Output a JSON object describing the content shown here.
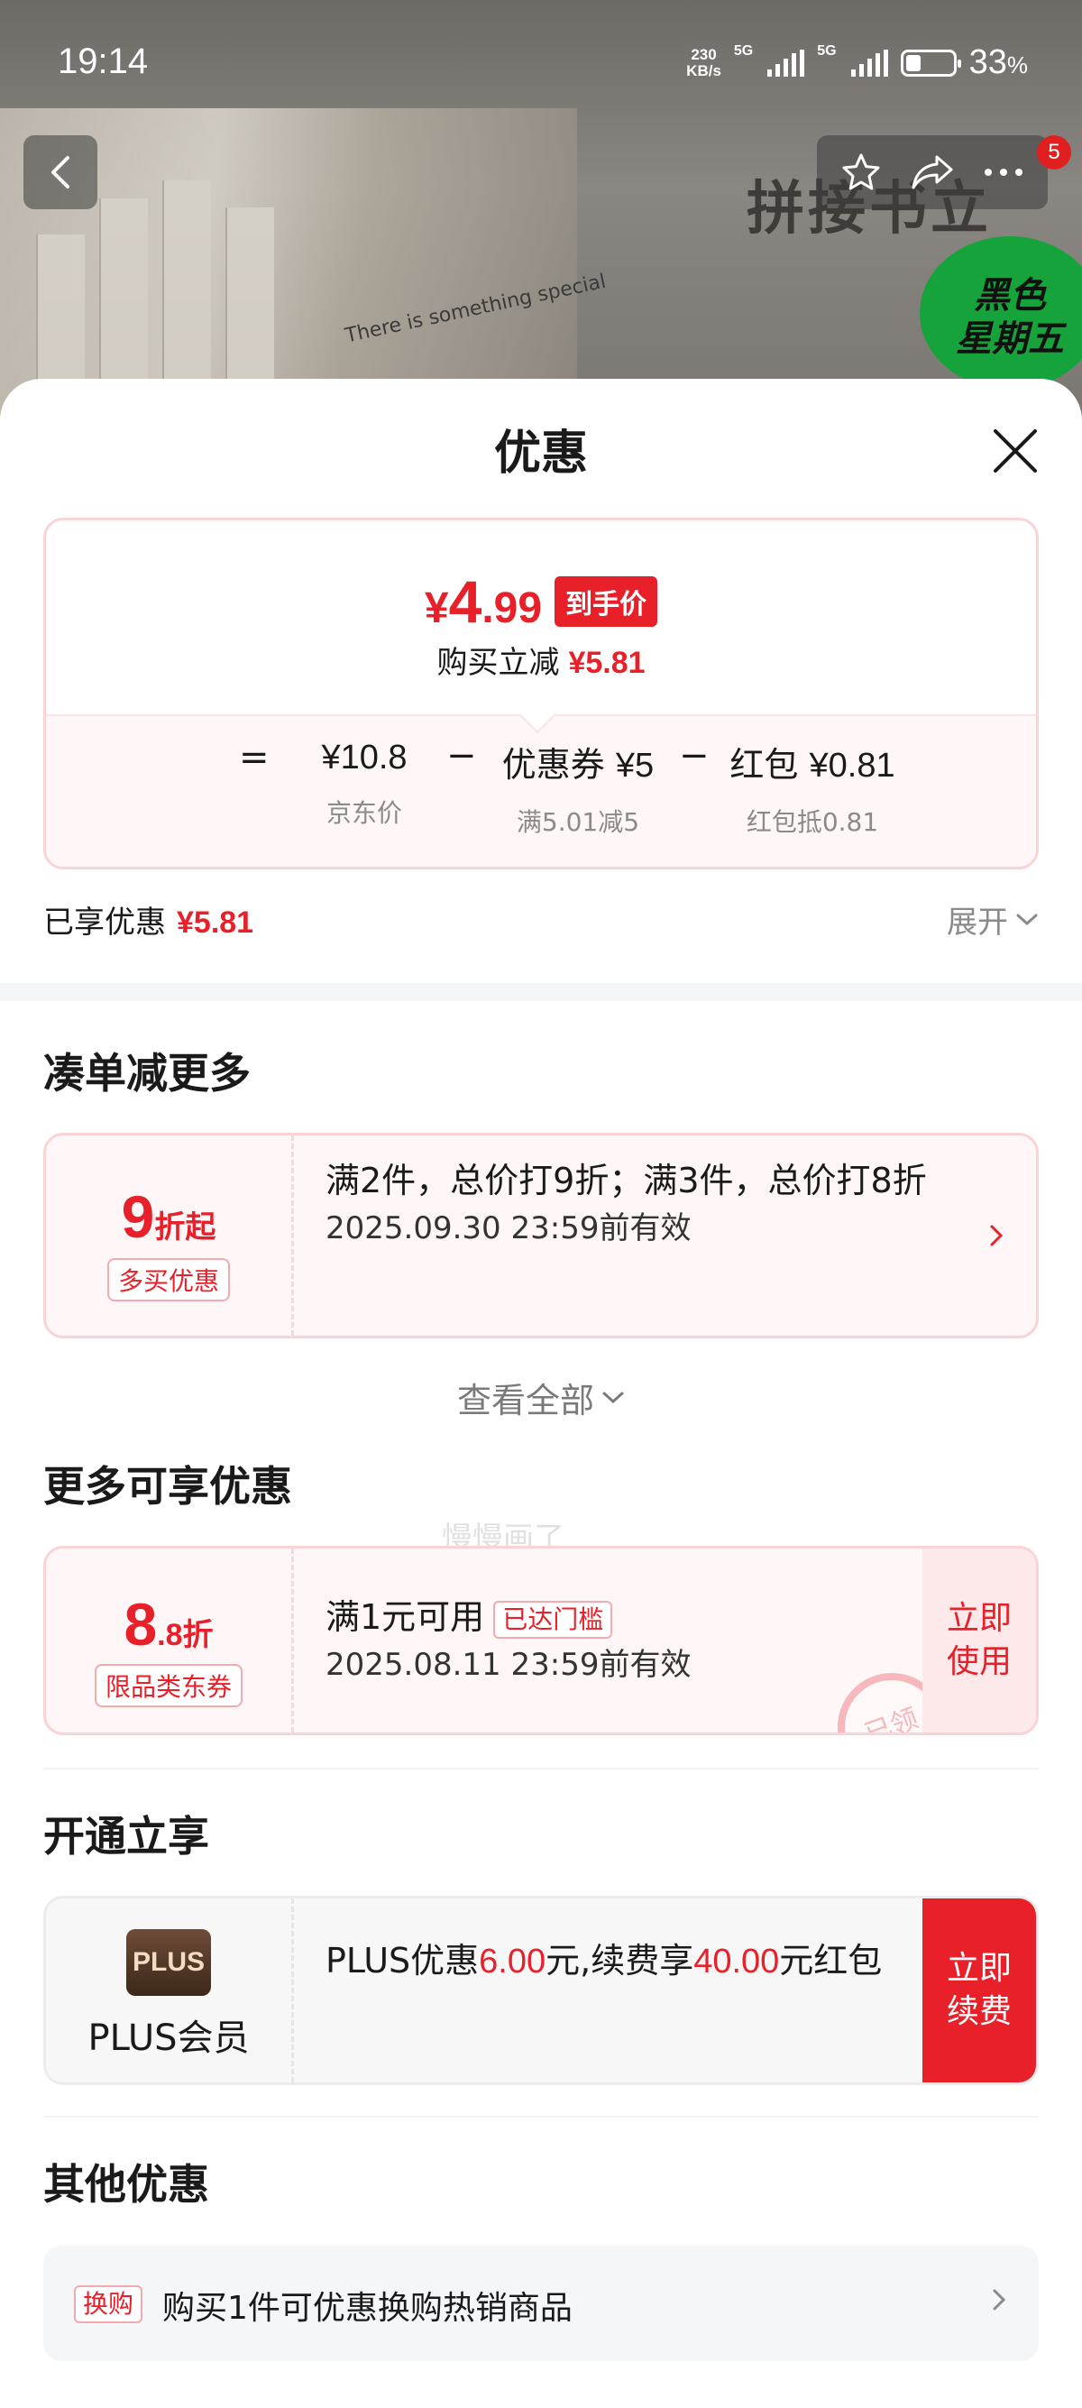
{
  "status_bar": {
    "time": "19:14",
    "net_speed": "230\nKB/s",
    "sig1": "5G",
    "sig2": "5G",
    "battery_pct": "33",
    "battery_unit": "%"
  },
  "background": {
    "tagline": "There is something special",
    "title_art": "拼接书立",
    "promo": "黑色\n星期五",
    "cart_badge": "5"
  },
  "sheet": {
    "title": "优惠"
  },
  "summary": {
    "final_yen": "¥",
    "final_int": "4",
    "final_dec": ".99",
    "final_tag": "到手价",
    "reduce_label": "购买立减",
    "reduce_amount": "¥5.81",
    "calc": {
      "eq": "=",
      "minus1": "−",
      "minus2": "−",
      "items": [
        {
          "value": "¥10.8",
          "label": "京东价"
        },
        {
          "value_prefix": "优惠券",
          "value": "¥5",
          "label": "满5.01减5"
        },
        {
          "value_prefix": "红包",
          "value": "¥0.81",
          "label": "红包抵0.81"
        }
      ]
    }
  },
  "enjoyed": {
    "label": "已享优惠",
    "amount": "¥5.81",
    "expand": "展开"
  },
  "section1": {
    "title": "凑单减更多",
    "card": {
      "big": "9",
      "big_suffix": "折起",
      "tag": "多买优惠",
      "line1": "满2件，总价打9折；满3件，总价打8折",
      "line2": "2025.09.30 23:59前有效"
    },
    "view_all": "查看全部",
    "watermark": "慢慢画了"
  },
  "section2": {
    "title": "更多可享优惠",
    "card": {
      "big": "8",
      "big_dec": ".8",
      "big_suffix": "折",
      "tag": "限品类东券",
      "line1": "满1元可用",
      "threshold": "已达门槛",
      "line2": "2025.08.11 23:59前有效",
      "button": "立即\n使用",
      "stamp": "已领"
    }
  },
  "section3": {
    "title": "开通立享",
    "plus": {
      "logo": "PLUS",
      "name": "PLUS会员",
      "text_a": "PLUS优惠",
      "amount_a": "6.00",
      "text_b": "元,续费享",
      "amount_b": "40.00",
      "text_c": "元红包",
      "button": "立即\n续费"
    }
  },
  "section4": {
    "title": "其他优惠",
    "row": {
      "tag": "换购",
      "text": "购买1件可优惠换购热销商品"
    }
  },
  "colors": {
    "accent_red": "#e8202a",
    "card_border": "#f9d3d6",
    "card_bg": "#fff6f7"
  }
}
